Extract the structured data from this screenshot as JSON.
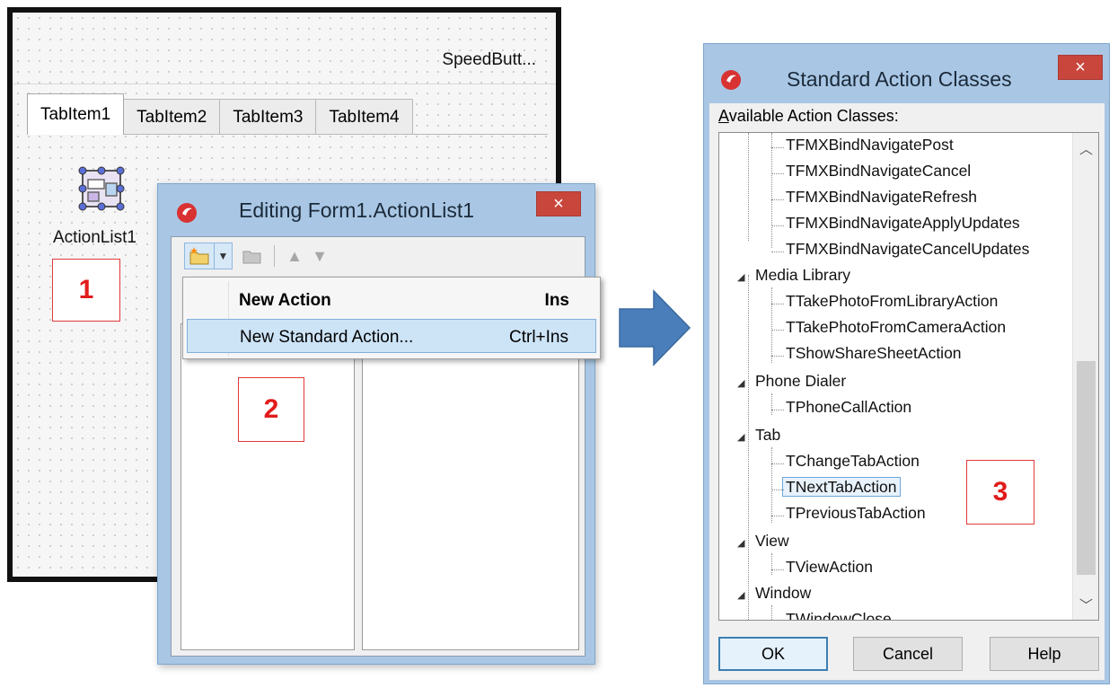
{
  "form_designer": {
    "speed_button": "SpeedButt...",
    "tabs": [
      "TabItem1",
      "TabItem2",
      "TabItem3",
      "TabItem4"
    ],
    "component_label": "ActionList1",
    "component_icon": "action-list-icon"
  },
  "callouts": [
    "1",
    "2",
    "3"
  ],
  "edit_dialog": {
    "title": "Editing Form1.ActionList1",
    "close": "×",
    "toolbar": {
      "new_icon": "new-action-icon",
      "dropdown_icon": "chevron-down-icon",
      "delete_icon": "delete-action-icon",
      "up_icon": "arrow-up-icon",
      "down_icon": "arrow-down-icon"
    },
    "menu": [
      {
        "label": "New Action",
        "shortcut": "Ins"
      },
      {
        "label": "New Standard Action...",
        "shortcut": "Ctrl+Ins"
      }
    ]
  },
  "arrow_icon": "right-arrow-icon",
  "std_dialog": {
    "title": "Standard Action Classes",
    "close": "×",
    "available_label_prefix": "A",
    "available_label_rest": "vailable Action Classes:",
    "tree": {
      "top_items": [
        "TFMXBindNavigatePost",
        "TFMXBindNavigateCancel",
        "TFMXBindNavigateRefresh",
        "TFMXBindNavigateApplyUpdates",
        "TFMXBindNavigateCancelUpdates"
      ],
      "groups": [
        {
          "name": "Media Library",
          "items": [
            "TTakePhotoFromLibraryAction",
            "TTakePhotoFromCameraAction",
            "TShowShareSheetAction"
          ]
        },
        {
          "name": "Phone Dialer",
          "items": [
            "TPhoneCallAction"
          ]
        },
        {
          "name": "Tab",
          "items": [
            "TChangeTabAction",
            "TNextTabAction",
            "TPreviousTabAction"
          ]
        },
        {
          "name": "View",
          "items": [
            "TViewAction"
          ]
        },
        {
          "name": "Window",
          "items": [
            "TWindowClose"
          ]
        }
      ],
      "selected": "TNextTabAction"
    },
    "buttons": {
      "ok": "OK",
      "cancel": "Cancel",
      "help": "Help"
    }
  }
}
